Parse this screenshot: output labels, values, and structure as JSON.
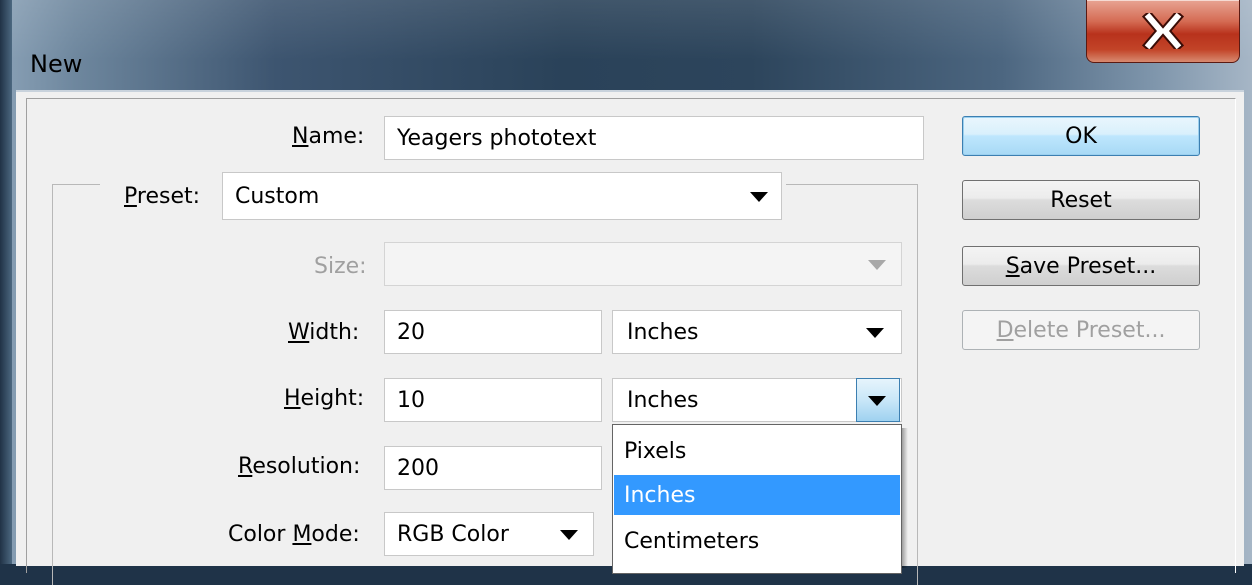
{
  "window": {
    "title": "New",
    "close_icon": "close-icon"
  },
  "form": {
    "name": {
      "label_key": "N",
      "label_rest": "ame:",
      "value": "Yeagers phototext"
    },
    "preset": {
      "label_key": "P",
      "label_rest": "reset:",
      "value": "Custom"
    },
    "size": {
      "label": "Size:",
      "value": ""
    },
    "width": {
      "label_key": "W",
      "label_rest": "idth:",
      "value": "20",
      "unit": "Inches"
    },
    "height": {
      "label_key": "H",
      "label_rest": "eight:",
      "value": "10",
      "unit": "Inches"
    },
    "resolution": {
      "label_key": "R",
      "label_rest": "esolution:",
      "value": "200"
    },
    "color_mode": {
      "label_pre": "Color ",
      "label_key": "M",
      "label_rest": "ode:",
      "value": "RGB Color"
    }
  },
  "unit_dropdown": {
    "options": [
      "Pixels",
      "Inches",
      "Centimeters"
    ],
    "selected": "Inches"
  },
  "buttons": {
    "ok": "OK",
    "reset": "Reset",
    "save_preset_key": "S",
    "save_preset_rest": "ave Preset...",
    "delete_preset_key": "D",
    "delete_preset_rest": "elete Preset..."
  },
  "colors": {
    "accent": "#3399ff",
    "close_button": "#c24428",
    "dialog_bg": "#f0f0f0"
  }
}
